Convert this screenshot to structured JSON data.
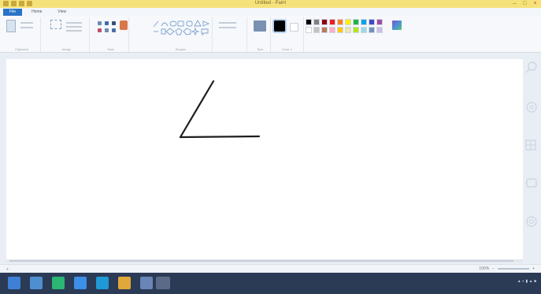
{
  "window": {
    "title": "Untitled - Paint"
  },
  "tabs": [
    {
      "label": "File"
    },
    {
      "label": "Home"
    },
    {
      "label": "View"
    }
  ],
  "ribbon": {
    "groups": [
      {
        "label": "Clipboard"
      },
      {
        "label": "Image"
      },
      {
        "label": "Tools"
      },
      {
        "label": "Brushes"
      },
      {
        "label": "Shapes"
      },
      {
        "label": "Size"
      },
      {
        "label": "Colors"
      }
    ],
    "buttons": {
      "paste": "Paste",
      "select": "Select",
      "brushes": "Brushes",
      "size": "Size",
      "color1": "Color 1",
      "color2": "Color 2",
      "edit_colors": "Edit colors"
    },
    "palette": [
      "#000000",
      "#7f7f7f",
      "#880015",
      "#ed1c24",
      "#ff7f27",
      "#fff200",
      "#22b14c",
      "#00a2e8",
      "#3f48cc",
      "#a349a4",
      "#ffffff",
      "#c3c3c3",
      "#b97a57",
      "#ffaec9",
      "#ffc90e",
      "#efe4b0",
      "#b5e61d",
      "#99d9ea",
      "#7092be",
      "#c8bfe7"
    ]
  },
  "status": {
    "position": "",
    "selection": "",
    "zoom": "100%"
  },
  "taskbar": {
    "clock": ""
  }
}
